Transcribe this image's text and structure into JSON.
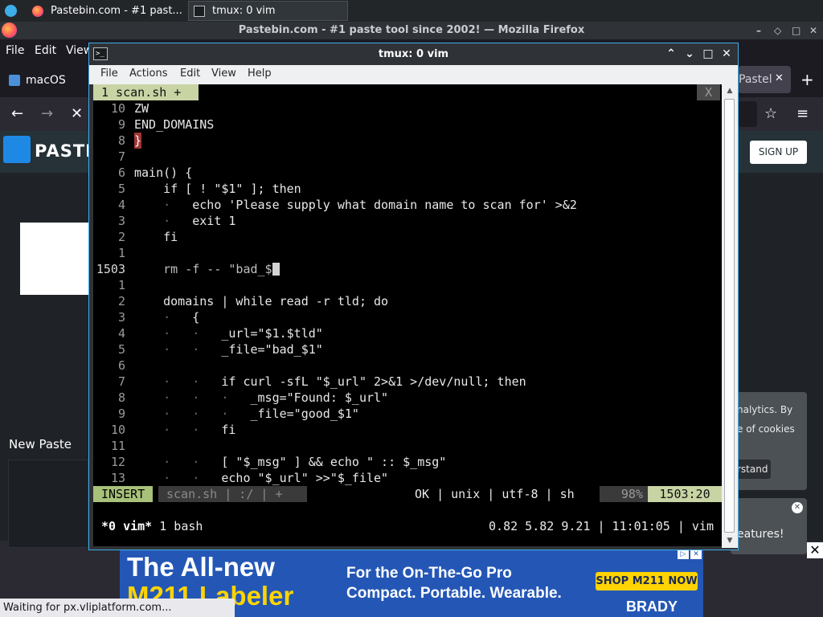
{
  "taskbar": {
    "tasks": [
      {
        "label": "Pastebin.com - #1 past...",
        "icon": "firefox-icon"
      },
      {
        "label": "tmux: 0 vim",
        "icon": "terminal-icon"
      }
    ]
  },
  "firefox": {
    "title": "Pastebin.com - #1 paste tool since 2002! — Mozilla Firefox",
    "window_controls": [
      "–",
      "◇",
      "□",
      "✕"
    ],
    "menu": [
      "File",
      "Edit",
      "View"
    ],
    "tabs": [
      {
        "label": "macOS",
        "icon": "macos-icon"
      },
      {
        "label": "Pastel",
        "icon": "pastebin-icon"
      }
    ],
    "nav": {
      "back": "←",
      "forward": "→",
      "stop": "✕",
      "bookmark": "☆",
      "menu": "≡",
      "new_tab": "+"
    },
    "page": {
      "site_name": "PASTE",
      "signup_label": "SIGN UP",
      "new_paste_label": "New Paste",
      "cookie_text_line1": "nalytics. By",
      "cookie_text_line2": "e of cookies",
      "cookie_button": "rstand",
      "features_text": "eatures!"
    },
    "ad": {
      "headline_line1": "The All-new",
      "headline_line2": "M211 Labeler",
      "tagline_line1": "For the On-The-Go Pro",
      "tagline_line2": "Compact. Portable. Wearable.",
      "cta": "SHOP M211 NOW",
      "brand": "BRADY"
    },
    "status": "Waiting for px.vliplatform.com..."
  },
  "terminal": {
    "title": "tmux: 0 vim",
    "menu": [
      "File",
      "Actions",
      "Edit",
      "View",
      "Help"
    ],
    "vim": {
      "tab_label": "1 scan.sh +",
      "tab_close": "X",
      "lines": [
        {
          "num": "10",
          "text": "ZW"
        },
        {
          "num": "9",
          "text": "END_DOMAINS"
        },
        {
          "num": "8",
          "text": "}"
        },
        {
          "num": "7",
          "text": ""
        },
        {
          "num": "6",
          "text": "main() {"
        },
        {
          "num": "5",
          "text": "    if [ ! \"$1\" ]; then"
        },
        {
          "num": "4",
          "text": "    ·   echo 'Please supply what domain name to scan for' >&2"
        },
        {
          "num": "3",
          "text": "    ·   exit 1"
        },
        {
          "num": "2",
          "text": "    fi"
        },
        {
          "num": "1",
          "text": ""
        },
        {
          "num": "1503",
          "text": "    rm -f -- \"bad_$"
        },
        {
          "num": "1",
          "text": ""
        },
        {
          "num": "2",
          "text": "    domains | while read -r tld; do"
        },
        {
          "num": "3",
          "text": "    ·   {"
        },
        {
          "num": "4",
          "text": "    ·   ·   _url=\"$1.$tld\""
        },
        {
          "num": "5",
          "text": "    ·   ·   _file=\"bad_$1\""
        },
        {
          "num": "6",
          "text": ""
        },
        {
          "num": "7",
          "text": "    ·   ·   if curl -sfL \"$_url\" 2>&1 >/dev/null; then"
        },
        {
          "num": "8",
          "text": "    ·   ·   ·   _msg=\"Found: $_url\""
        },
        {
          "num": "9",
          "text": "    ·   ·   ·   _file=\"good_$1\""
        },
        {
          "num": "10",
          "text": "    ·   ·   fi"
        },
        {
          "num": "11",
          "text": ""
        },
        {
          "num": "12",
          "text": "    ·   ·   [ \"$_msg\" ] && echo \" :: $_msg\""
        },
        {
          "num": "13",
          "text": "    ·   ·   echo \"$_url\" >>\"$_file\""
        }
      ],
      "status": {
        "mode": "INSERT",
        "file": "scan.sh | :/ | +",
        "info": "OK | unix | utf-8 | sh",
        "percent": "98%",
        "position": "1503:20"
      }
    },
    "tmux": {
      "window": "*0 vim*",
      "rest": " 1 bash",
      "right": "0.82 5.82 9.21 | 11:01:05 | vim"
    }
  },
  "colors": {
    "accent": "#3daee9",
    "vim_tab": "#c8d4a4",
    "vim_insert": "#a8c27a",
    "ad_blue": "#2457b5",
    "ad_yellow": "#ffd400"
  }
}
